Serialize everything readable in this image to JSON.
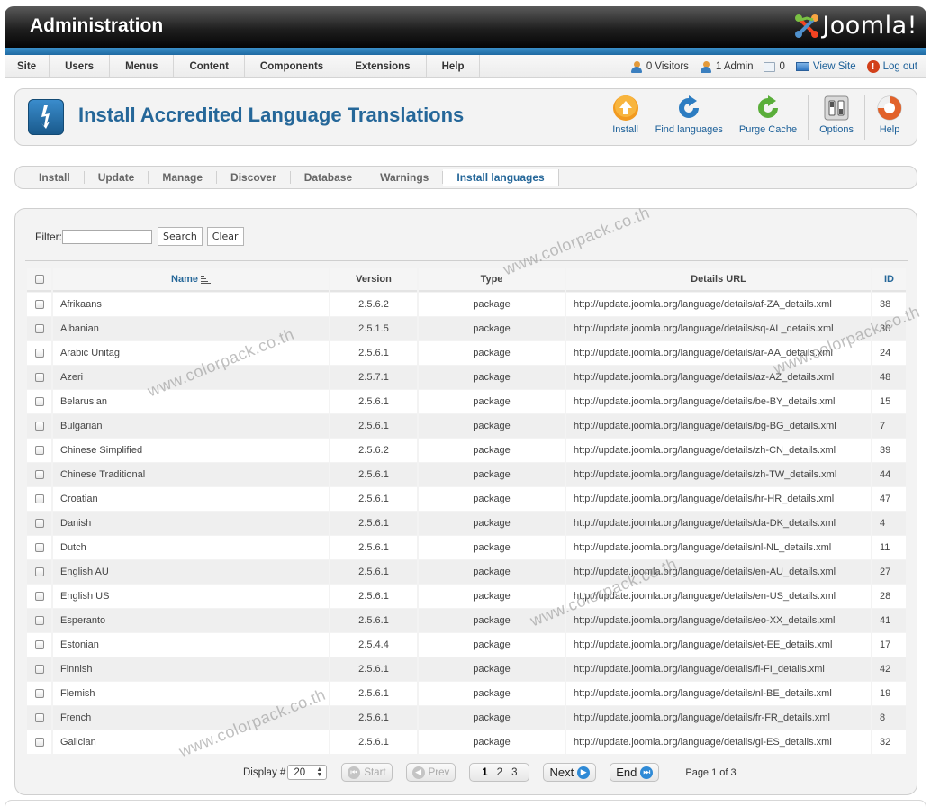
{
  "header": {
    "title": "Administration",
    "logo_text": "Joomla!"
  },
  "menubar": {
    "items": [
      "Site",
      "Users",
      "Menus",
      "Content",
      "Components",
      "Extensions",
      "Help"
    ]
  },
  "status": {
    "visitors": "0 Visitors",
    "admins": "1 Admin",
    "messages": "0",
    "view_site": "View Site",
    "logout": "Log out"
  },
  "toolbar": {
    "page_title": "Install Accredited Language Translations",
    "buttons": {
      "install": "Install",
      "find_languages": "Find languages",
      "purge_cache": "Purge Cache",
      "options": "Options",
      "help": "Help"
    }
  },
  "subnav": {
    "tabs": [
      "Install",
      "Update",
      "Manage",
      "Discover",
      "Database",
      "Warnings",
      "Install languages"
    ],
    "active": "Install languages"
  },
  "filter": {
    "label": "Filter:",
    "value": "",
    "search_label": "Search",
    "clear_label": "Clear"
  },
  "table": {
    "columns": {
      "name": "Name",
      "version": "Version",
      "type": "Type",
      "details_url": "Details URL",
      "id": "ID"
    },
    "rows": [
      {
        "name": "Afrikaans",
        "version": "2.5.6.2",
        "type": "package",
        "url": "http://update.joomla.org/language/details/af-ZA_details.xml",
        "id": "38"
      },
      {
        "name": "Albanian",
        "version": "2.5.1.5",
        "type": "package",
        "url": "http://update.joomla.org/language/details/sq-AL_details.xml",
        "id": "30"
      },
      {
        "name": "Arabic Unitag",
        "version": "2.5.6.1",
        "type": "package",
        "url": "http://update.joomla.org/language/details/ar-AA_details.xml",
        "id": "24"
      },
      {
        "name": "Azeri",
        "version": "2.5.7.1",
        "type": "package",
        "url": "http://update.joomla.org/language/details/az-AZ_details.xml",
        "id": "48"
      },
      {
        "name": "Belarusian",
        "version": "2.5.6.1",
        "type": "package",
        "url": "http://update.joomla.org/language/details/be-BY_details.xml",
        "id": "15"
      },
      {
        "name": "Bulgarian",
        "version": "2.5.6.1",
        "type": "package",
        "url": "http://update.joomla.org/language/details/bg-BG_details.xml",
        "id": "7"
      },
      {
        "name": "Chinese Simplified",
        "version": "2.5.6.2",
        "type": "package",
        "url": "http://update.joomla.org/language/details/zh-CN_details.xml",
        "id": "39"
      },
      {
        "name": "Chinese Traditional",
        "version": "2.5.6.1",
        "type": "package",
        "url": "http://update.joomla.org/language/details/zh-TW_details.xml",
        "id": "44"
      },
      {
        "name": "Croatian",
        "version": "2.5.6.1",
        "type": "package",
        "url": "http://update.joomla.org/language/details/hr-HR_details.xml",
        "id": "47"
      },
      {
        "name": "Danish",
        "version": "2.5.6.1",
        "type": "package",
        "url": "http://update.joomla.org/language/details/da-DK_details.xml",
        "id": "4"
      },
      {
        "name": "Dutch",
        "version": "2.5.6.1",
        "type": "package",
        "url": "http://update.joomla.org/language/details/nl-NL_details.xml",
        "id": "11"
      },
      {
        "name": "English AU",
        "version": "2.5.6.1",
        "type": "package",
        "url": "http://update.joomla.org/language/details/en-AU_details.xml",
        "id": "27"
      },
      {
        "name": "English US",
        "version": "2.5.6.1",
        "type": "package",
        "url": "http://update.joomla.org/language/details/en-US_details.xml",
        "id": "28"
      },
      {
        "name": "Esperanto",
        "version": "2.5.6.1",
        "type": "package",
        "url": "http://update.joomla.org/language/details/eo-XX_details.xml",
        "id": "41"
      },
      {
        "name": "Estonian",
        "version": "2.5.4.4",
        "type": "package",
        "url": "http://update.joomla.org/language/details/et-EE_details.xml",
        "id": "17"
      },
      {
        "name": "Finnish",
        "version": "2.5.6.1",
        "type": "package",
        "url": "http://update.joomla.org/language/details/fi-FI_details.xml",
        "id": "42"
      },
      {
        "name": "Flemish",
        "version": "2.5.6.1",
        "type": "package",
        "url": "http://update.joomla.org/language/details/nl-BE_details.xml",
        "id": "19"
      },
      {
        "name": "French",
        "version": "2.5.6.1",
        "type": "package",
        "url": "http://update.joomla.org/language/details/fr-FR_details.xml",
        "id": "8"
      },
      {
        "name": "Galician",
        "version": "2.5.6.1",
        "type": "package",
        "url": "http://update.joomla.org/language/details/gl-ES_details.xml",
        "id": "32"
      }
    ]
  },
  "pagination": {
    "display_label": "Display #",
    "limit": "20",
    "start": "Start",
    "prev": "Prev",
    "pages": [
      "1",
      "2",
      "3"
    ],
    "current_page": "1",
    "next": "Next",
    "end": "End",
    "page_of": "Page 1 of 3"
  },
  "watermark": "www.colorpack.co.th",
  "colors": {
    "accent_blue": "#256799",
    "link_blue": "#1b5f98",
    "header_strip": "#2a7bbf"
  }
}
